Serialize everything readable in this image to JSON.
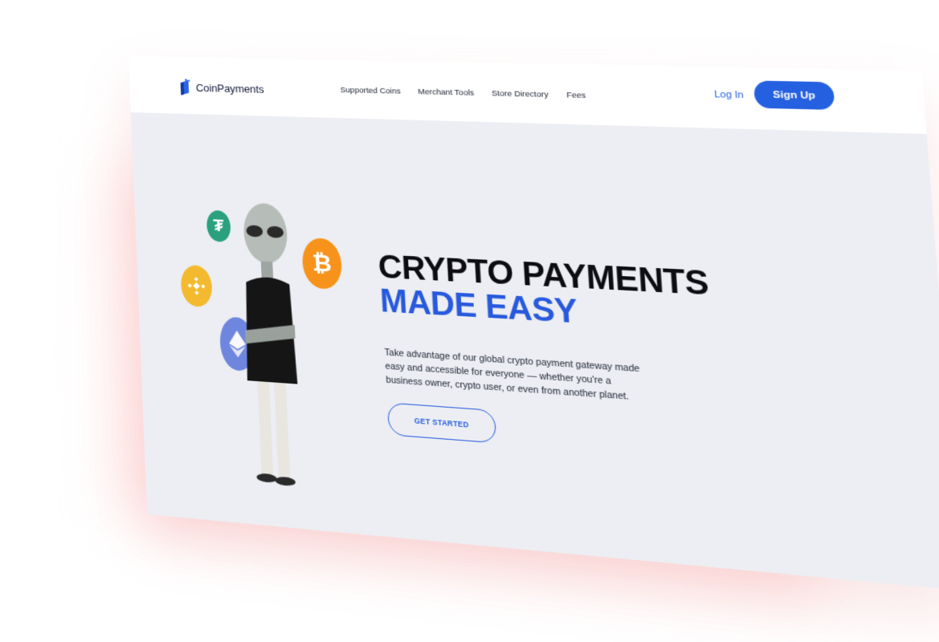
{
  "brand": {
    "name": "CoinPayments",
    "accent": "#2560e0",
    "text": "#11183a"
  },
  "nav": {
    "items": [
      "Supported Coins",
      "Merchant Tools",
      "Store Directory",
      "Fees"
    ],
    "login": "Log In",
    "signup": "Sign Up"
  },
  "hero": {
    "title_line1": "CRYPTO PAYMENTS",
    "title_line2": "MADE EASY",
    "description": "Take advantage of our global crypto payment gateway made easy and accessible for everyone — whether you're a business owner, crypto user, or even from another planet.",
    "cta": "GET STARTED"
  },
  "coins": [
    {
      "name": "tether-icon",
      "color": "#2aa07d"
    },
    {
      "name": "binance-icon",
      "color": "#f3ba2f"
    },
    {
      "name": "bitcoin-icon",
      "color": "#f7931a"
    },
    {
      "name": "ethereum-icon",
      "color": "#6f86df"
    }
  ]
}
